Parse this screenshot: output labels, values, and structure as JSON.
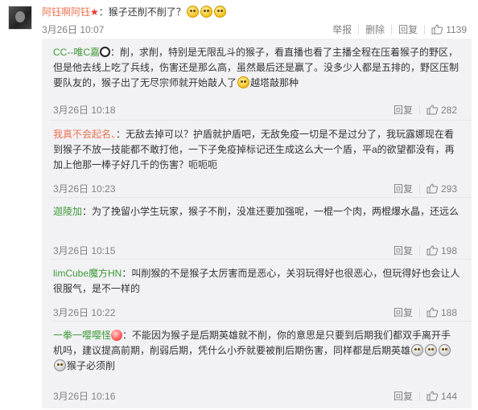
{
  "main": {
    "username": "阿钰啊阿钰",
    "text": "：猴子还削不削了？",
    "time": "3月26日 10:07",
    "actions": {
      "report": "举报",
      "delete": "删除",
      "reply": "回复",
      "likes": "1139"
    }
  },
  "replies": [
    {
      "username": "CC--唯C嘉",
      "text_a": "：削，求削，特别是无限乱斗的猴子，看直播也看了主播全程在压着猴子的野区，但是他去线上吃了兵线，伤害还是那么高，虽然最后还是赢了。没多少人都是五排的，野区压制要队友的，猴子出了无尽宗师就开始敲人了",
      "text_b": "越塔敲那种",
      "time": "3月26日 10:18",
      "reply_label": "回复",
      "likes": "282"
    },
    {
      "username": "我真不会起名、",
      "text_a": "：无敌去掉可以？护盾就护盾吧，无敌免疫一切是不是过分了，我玩露娜现在看到猴子不放一技能都不敢打他，一下子免疫掉标记还生成这么大一个盾，平a的欲望都没有，再加上他那一棒子好几千的伤害？呃呃呃",
      "time": "3月26日 10:23",
      "reply_label": "回复",
      "likes": "293"
    },
    {
      "username": "迦陵加",
      "text_a": "：为了挽留小学生玩家，猴子不削，没准还要加强呢，一棍一个肉，两棍爆水晶，还远么",
      "time": "3月26日 10:15",
      "reply_label": "回复",
      "likes": "198"
    },
    {
      "username": "limCube魔方HN",
      "text_a": "：叫削猴的不是猴子太厉害而是恶心，关羽玩得好也很恶心，但玩得好也会让人很服气，是不一样的",
      "time": "3月26日 10:22",
      "reply_label": "回复",
      "likes": "188"
    },
    {
      "username": "一拳一嘤嘤怪",
      "text_a": "：不能因为猴子是后期英雄就不削，你的意思是只要到后期我们都双手离开手机吗，建议提高前期，削弱后期，凭什么小乔就要被削后期伤害，同样都是后期英雄",
      "text_b": "猴子必须削",
      "time": "3月26日 10:16",
      "reply_label": "回复",
      "likes": "144"
    }
  ],
  "colors": {
    "username": "#eb7350",
    "username_green": "#3e9a37",
    "meta": "#808080",
    "reply_bg": "#f2f2f5"
  },
  "icons": {
    "like": "thumbs-up-icon",
    "vip": "red-star-icon"
  }
}
